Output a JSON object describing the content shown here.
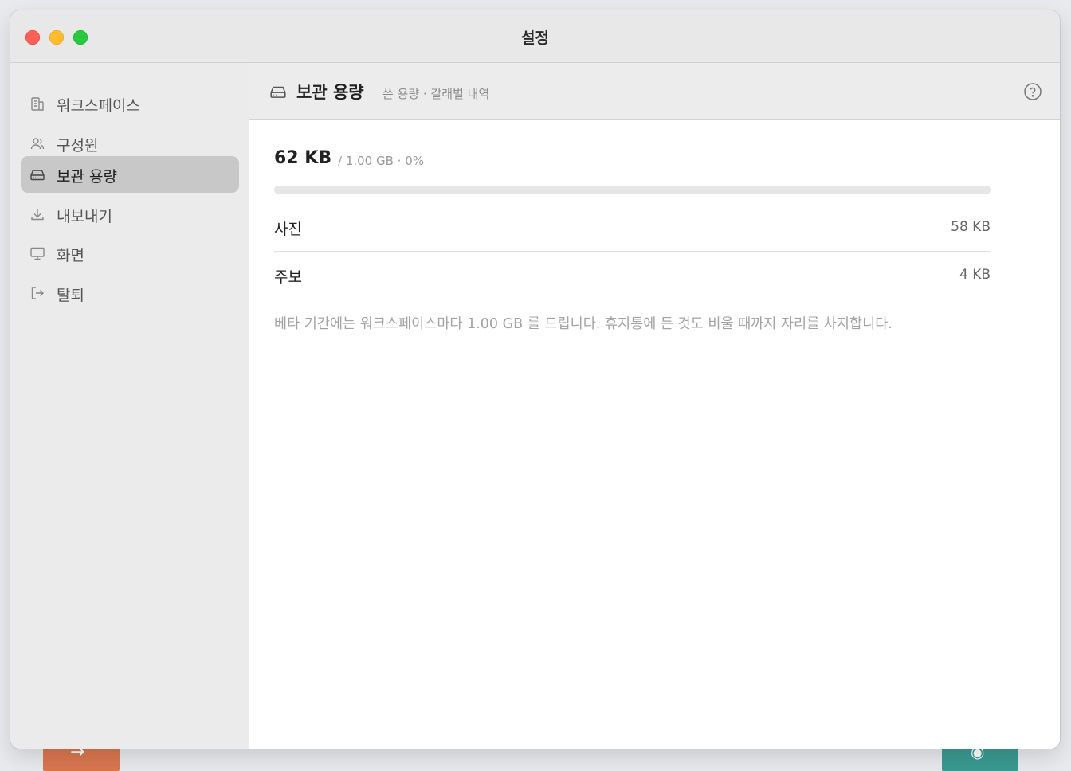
{
  "window": {
    "title": "설정"
  },
  "sidebar": {
    "items": [
      {
        "label": "워크스페이스",
        "icon": "building-icon"
      },
      {
        "label": "구성원",
        "icon": "users-icon"
      },
      {
        "label": "보관 용량",
        "icon": "hard-drive-icon",
        "active": true
      },
      {
        "label": "내보내기",
        "icon": "download-icon"
      },
      {
        "label": "화면",
        "icon": "monitor-icon"
      },
      {
        "label": "탈퇴",
        "icon": "logout-icon"
      }
    ]
  },
  "header": {
    "title": "보관 용량",
    "subtitle": "쓴 용량 · 갈래별 내역",
    "icon": "hard-drive-icon",
    "help_icon": "help-circle-icon"
  },
  "usage": {
    "used": "62 KB",
    "meta": "/ 1.00 GB · 0%",
    "percent": 0
  },
  "breakdown": [
    {
      "label": "사진",
      "value": "58 KB"
    },
    {
      "label": "주보",
      "value": "4 KB"
    }
  ],
  "note": "베타 기간에는 워크스페이스마다 1.00 GB 를 드립니다. 휴지통에 든 것도 비울 때까지 자리를 차지합니다.",
  "background": {
    "left_button_icon": "arrow-right-icon",
    "right_button_icon": "radio-icon",
    "colors": {
      "left": "#d9774f",
      "right": "#3a9a92"
    }
  },
  "colors": {
    "sidebar_active": "#c8c8c8",
    "traffic_close": "#fe5f57",
    "traffic_min": "#febc2e",
    "traffic_max": "#28c840"
  }
}
